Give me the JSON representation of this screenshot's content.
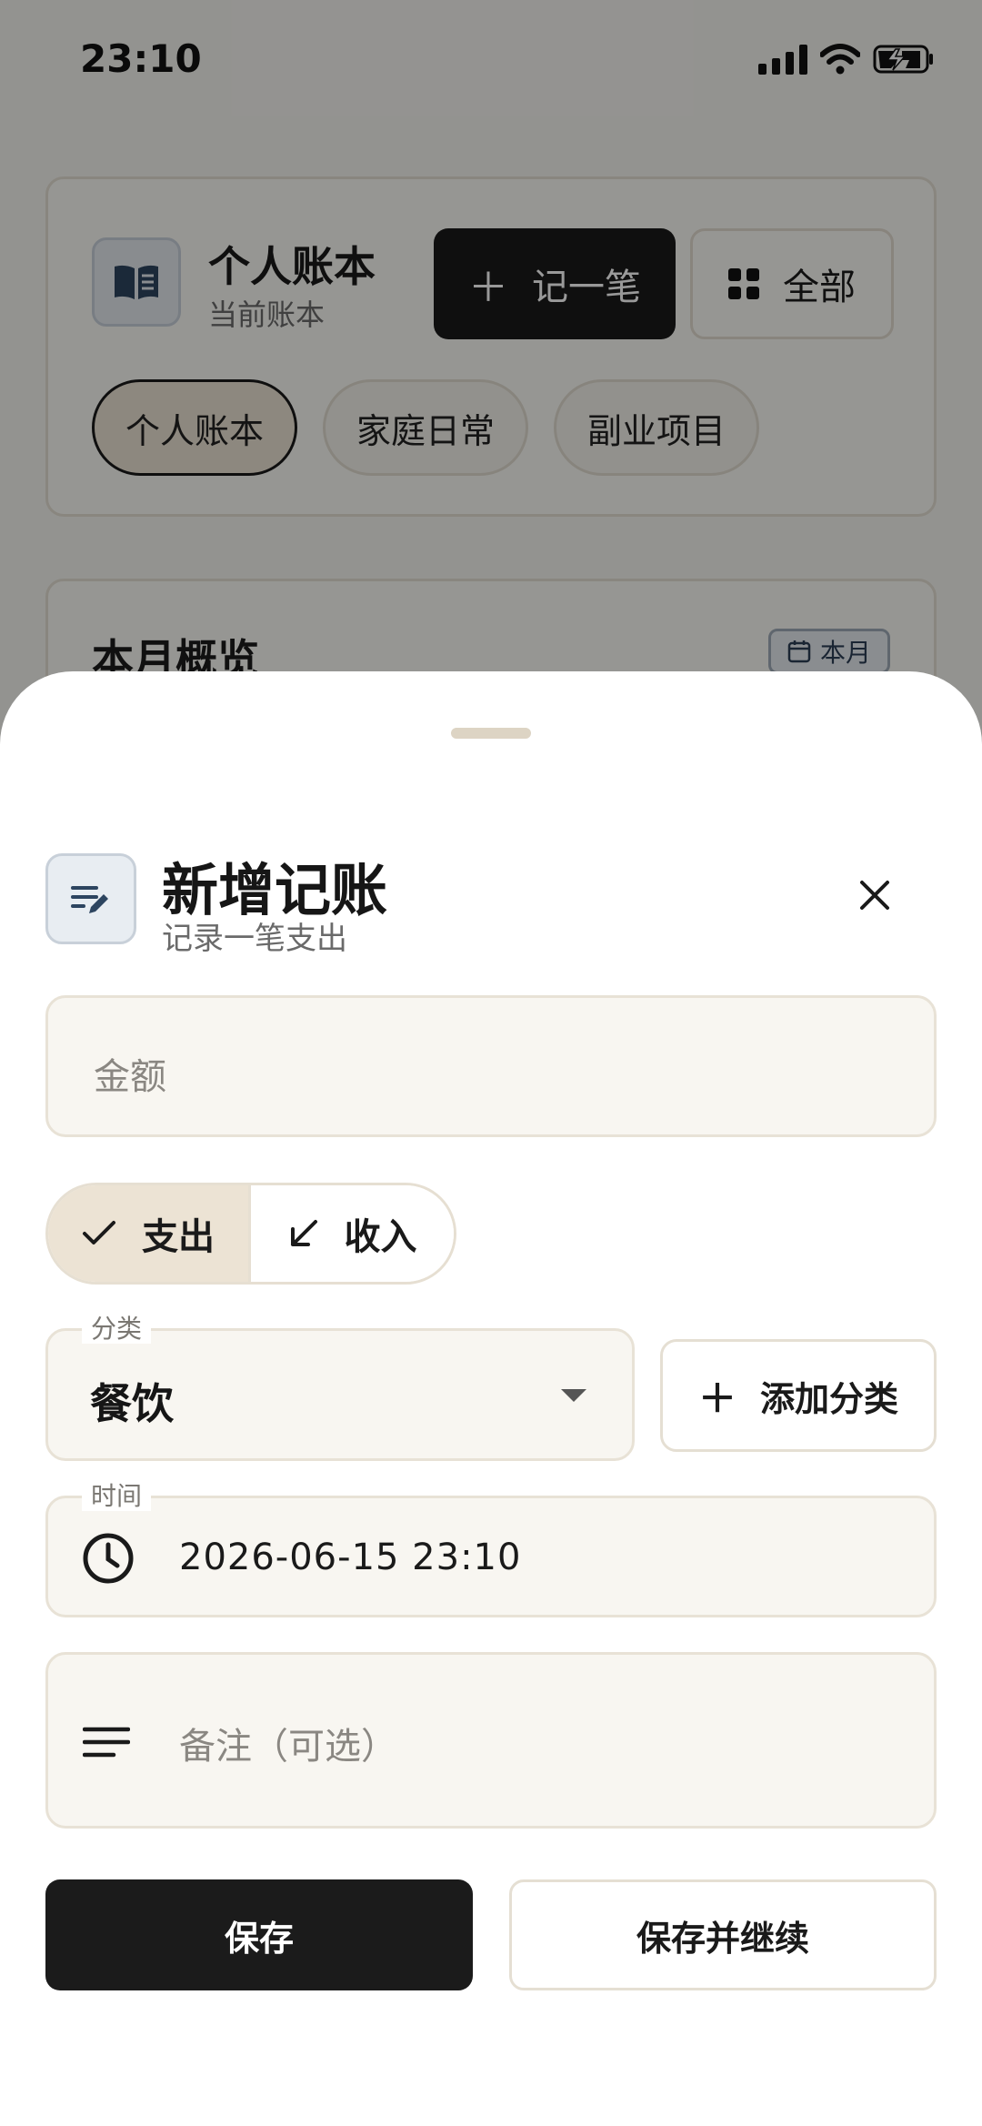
{
  "status_bar": {
    "time": "23:10"
  },
  "book": {
    "title": "个人账本",
    "subtitle": "当前账本",
    "record_button": "记一笔",
    "all_button": "全部",
    "chips": [
      "个人账本",
      "家庭日常",
      "副业项目"
    ]
  },
  "overview": {
    "title": "本月概览",
    "badge": "本月"
  },
  "sheet": {
    "title": "新增记账",
    "subtitle": "记录一笔支出",
    "amount_placeholder": "金额",
    "type_expense": "支出",
    "type_income": "收入",
    "category_label": "分类",
    "category_value": "餐饮",
    "add_category": "添加分类",
    "time_label": "时间",
    "time_value": "2026-06-15 23:10",
    "note_placeholder": "备注（可选）",
    "save": "保存",
    "save_continue": "保存并继续"
  },
  "icons": {
    "book": "book-icon",
    "plus": "plus-icon",
    "grid": "grid-icon",
    "calendar": "calendar-icon",
    "edit": "edit-note-icon",
    "close": "close-icon",
    "check": "check-icon",
    "arrow": "arrow-down-left-icon",
    "clock": "clock-icon",
    "lines": "lines-icon"
  },
  "colors": {
    "accent_dark": "#1a1a1a",
    "selected_bg": "#ece3d4",
    "field_bg": "#f8f6f1",
    "border": "#e6dfd2"
  }
}
